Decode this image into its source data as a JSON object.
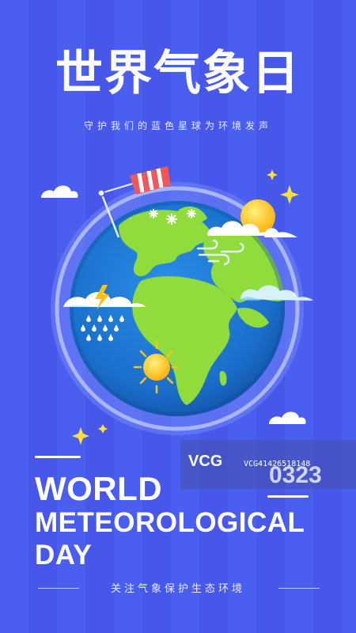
{
  "title": "世界气象日",
  "subtitle": "守护我们的蓝色星球为环境发声",
  "english_title": {
    "line1": "WORLD",
    "line2": "METEOROLOGICAL",
    "line3": "DAY"
  },
  "footer": "关注气象保护生态环境",
  "watermark": {
    "brand": "VCG",
    "id": "VCG41426518148",
    "code": "0323"
  },
  "colors": {
    "background": "#4a5ef0",
    "ocean": "#1c7ad6",
    "land": "#8fdc3c",
    "sun": "#ffc21a",
    "windsock": "#f0575c"
  },
  "icons": [
    "windsock-icon",
    "snowflake-icon",
    "sun-icon",
    "cloud-icon",
    "wind-icon",
    "rain-icon",
    "lightning-icon",
    "sparkle-icon"
  ]
}
